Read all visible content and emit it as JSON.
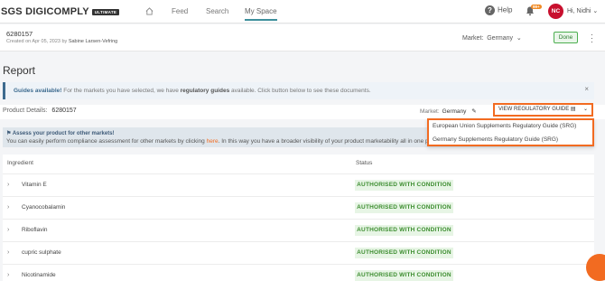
{
  "brand": {
    "name": "SGS DIGICOMPLY",
    "tier": "ULTIMATE"
  },
  "nav": {
    "feed": "Feed",
    "search": "Search",
    "my_space": "My Space"
  },
  "header_right": {
    "help": "Help",
    "notif_count": "99+",
    "avatar_initials": "NC",
    "greeting": "Hi, Nidhi"
  },
  "product": {
    "id": "6280157",
    "created_prefix": "Created on Apr 05, 2023 by",
    "created_by": "Sabine Larsen-Vefring",
    "market_label": "Market:",
    "market_value": "Germany",
    "done_label": "Done"
  },
  "report": {
    "title": "Report",
    "guide_badge": "Guides available!",
    "guide_text_1": "For the markets you have selected, we have",
    "guide_text_strong": "regulatory guides",
    "guide_text_2": "available. Click button below to see these documents.",
    "details_label": "Product Details:",
    "details_id": "6280157",
    "market_label": "Market:",
    "market_value": "Germany",
    "view_guide_button": "VIEW REGULATORY GUIDE",
    "assess_title": "Assess your product for other markets!",
    "assess_text_1": "You can easily perform compliance assessment for other markets by clicking",
    "assess_link": "here",
    "assess_text_2": ". In this way you have a broader visibility of your product marketability all in one pl"
  },
  "guide_options": [
    "European Union Supplements Regulatory Guide (SRG)",
    "Germany Supplements Regulatory Guide (SRG)"
  ],
  "table": {
    "col_ingredient": "Ingredient",
    "col_status": "Status",
    "rows": [
      {
        "ingredient": "Vitamin E",
        "status": "AUTHORISED WITH CONDITION"
      },
      {
        "ingredient": "Cyanocobalamin",
        "status": "AUTHORISED WITH CONDITION"
      },
      {
        "ingredient": "Riboflavin",
        "status": "AUTHORISED WITH CONDITION"
      },
      {
        "ingredient": "cupric sulphate",
        "status": "AUTHORISED WITH CONDITION"
      },
      {
        "ingredient": "Nicotinamide",
        "status": "AUTHORISED WITH CONDITION"
      }
    ]
  },
  "colors": {
    "accent": "#f26b21",
    "teal": "#3d8f9c",
    "status_green": "#3c8d2f",
    "brand_red": "#c8102e"
  }
}
